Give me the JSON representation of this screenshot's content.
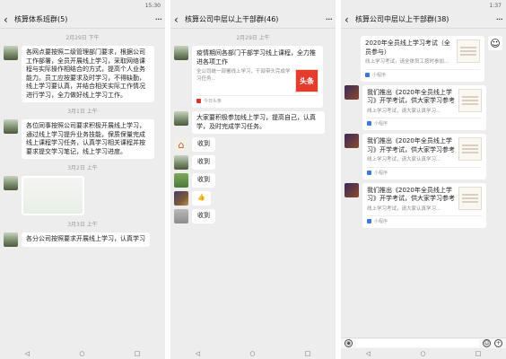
{
  "panels": [
    {
      "status": {
        "left": "",
        "right": "15:30"
      },
      "title": "核算体系班群(5)",
      "messages": [
        {
          "type": "time",
          "text": "2月29日 下午"
        },
        {
          "type": "text",
          "avatar": "mountain",
          "sender": "",
          "text": "各网点要按照二级管理部门要求，根据公司工作部署，全员开展线上学习，采取网络课程与实际操作相结合的方式，提高个人业务能力。员工应按要求及时学习，不得缺勤，线上学习要认真，并结合相关实际工作情况进行学习，全力做好线上学习工作。"
        },
        {
          "type": "time",
          "text": "3月1日 上午"
        },
        {
          "type": "text",
          "avatar": "mountain",
          "sender": "",
          "text": "各位同事按照公司要求积极开展线上学习，通过线上学习提升业务技能，保质保量完成线上课程学习任务，认真学习相关课程并按要求提交学习笔记，线上学习进度。"
        },
        {
          "type": "time",
          "text": "3月2日 上午"
        },
        {
          "type": "image",
          "avatar": "mountain",
          "sender": ""
        },
        {
          "type": "time",
          "text": "3月3日 上午"
        },
        {
          "type": "text",
          "avatar": "mountain",
          "sender": "",
          "text": "各分公司按照要求开展线上学习，认真学习"
        }
      ]
    },
    {
      "status": {
        "left": "",
        "right": ""
      },
      "title": "核算公司中层以上干部群(46)",
      "messages": [
        {
          "type": "time",
          "text": "2月29日 上午"
        },
        {
          "type": "card",
          "avatar": "mountain",
          "sender": "",
          "card_title": "疫情期间各部门干部学习线上课程，全力推进各项工作",
          "card_desc": "全公司统一部署线上学习，干部带头完成学习任务...",
          "thumb": "头条",
          "src": "今日头条"
        },
        {
          "type": "text",
          "avatar": "mountain",
          "sender": "",
          "text": "大家要积极参加线上学习，提高自己，认真学，及时完成学习任务。"
        },
        {
          "type": "text",
          "avatar": "house",
          "sender": "",
          "text": "收到"
        },
        {
          "type": "text",
          "avatar": "mountain",
          "sender": "",
          "text": "收到"
        },
        {
          "type": "text",
          "avatar": "grass",
          "sender": "",
          "text": "收到"
        },
        {
          "type": "text",
          "avatar": "dark",
          "sender": "",
          "text": "👍"
        },
        {
          "type": "text",
          "avatar": "gray",
          "sender": "",
          "text": "收到"
        }
      ]
    },
    {
      "status": {
        "left": "",
        "right": "1:37"
      },
      "title": "核算公司中层以上干部群(38)",
      "messages": [
        {
          "type": "card",
          "avatar": "cartoon",
          "side": "right",
          "sender": "",
          "card_title": "2020年全员线上学习考试（全员参与）",
          "card_desc": "线上学习考试，请全体员工按时参加...",
          "thumb": "doc",
          "src": "小程序"
        },
        {
          "type": "card",
          "avatar": "sport",
          "sender": "",
          "card_title": "我们推出《2020年全员线上学习》开学考试，供大家学习参考",
          "card_desc": "线上学习考试，请大家认真学习...",
          "thumb": "doc",
          "src": "小程序"
        },
        {
          "type": "card",
          "avatar": "sport",
          "sender": "",
          "card_title": "我们推出《2020年全员线上学习》开学考试，供大家学习参考",
          "card_desc": "线上学习考试，请大家认真学习...",
          "thumb": "doc",
          "src": "小程序"
        },
        {
          "type": "card",
          "avatar": "sport",
          "sender": "",
          "card_title": "我们推出《2020年全员线上学习》开学考试，供大家学习参考",
          "card_desc": "线上学习考试，请大家认真学习...",
          "thumb": "doc",
          "src": "小程序"
        }
      ]
    }
  ],
  "nav": {
    "back": "◁",
    "home": "○",
    "recent": "□"
  }
}
